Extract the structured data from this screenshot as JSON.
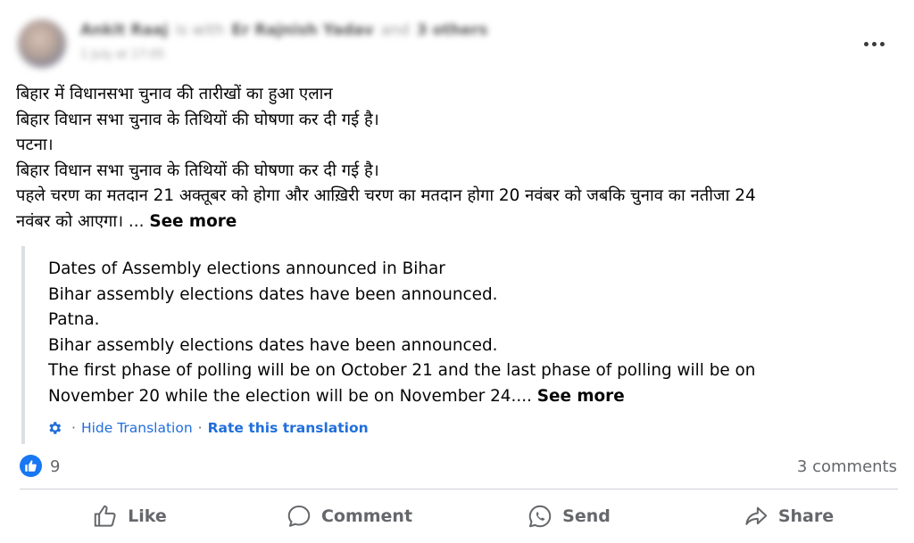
{
  "post": {
    "header": {
      "author_name": "Ankit Raaj",
      "with_text": "is with",
      "tagged_name": "Er Rajnish Yadav",
      "and_text": "and",
      "others_text": "3 others",
      "date": "1 July at 17:05",
      "more_icon": "more-horizontal-icon"
    },
    "text_lines": [
      "बिहार में विधानसभा चुनाव की तारीखों का हुआ एलान",
      "बिहार विधान सभा चुनाव के तिथियों की घोषणा कर दी गई है।",
      "पटना।",
      "बिहार विधान सभा चुनाव के तिथियों की घोषणा कर दी गई है।",
      "पहले चरण का मतदान 21 अक्तूबर को होगा और आख़िरी चरण का मतदान होगा 20 नवंबर को जबकि चुनाव का नतीजा 24"
    ],
    "text_last_line": "नवंबर को आएगा। ...",
    "see_more_label": "See more",
    "translation": {
      "lines": [
        "Dates of Assembly elections announced in Bihar",
        "Bihar assembly elections dates have been announced.",
        "Patna.",
        "Bihar assembly elections dates have been announced.",
        "The first phase of polling will be on October 21 and the last phase of polling will be on"
      ],
      "last_line": "November 20 while the election will be on November 24....",
      "see_more_label": "See more",
      "hide_label": "Hide Translation",
      "rate_label": "Rate this translation",
      "separator": "·"
    }
  },
  "reactions": {
    "like_count": "9",
    "comments_label": "3 comments"
  },
  "actions": {
    "like": "Like",
    "comment": "Comment",
    "send": "Send",
    "share": "Share"
  },
  "colors": {
    "link": "#216fdb",
    "muted": "#65676b",
    "like_blue": "#1877f2"
  }
}
